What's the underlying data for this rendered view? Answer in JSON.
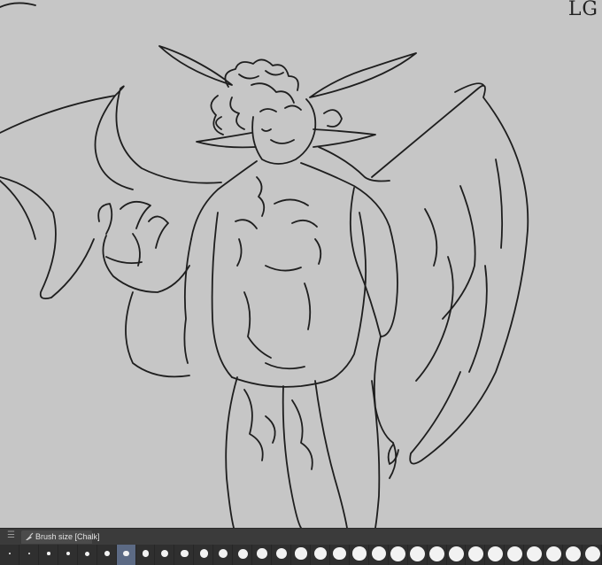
{
  "canvas": {
    "corner_text": "LG",
    "background": "#c6c6c6",
    "stroke_color": "#1e1e1e"
  },
  "brush_panel": {
    "tab_label": "Brush size [Chalk]",
    "tab_icon": "brush-icon",
    "menu_icon": "hamburger-menu-icon",
    "selected_index": 6,
    "preset_count": 31
  }
}
